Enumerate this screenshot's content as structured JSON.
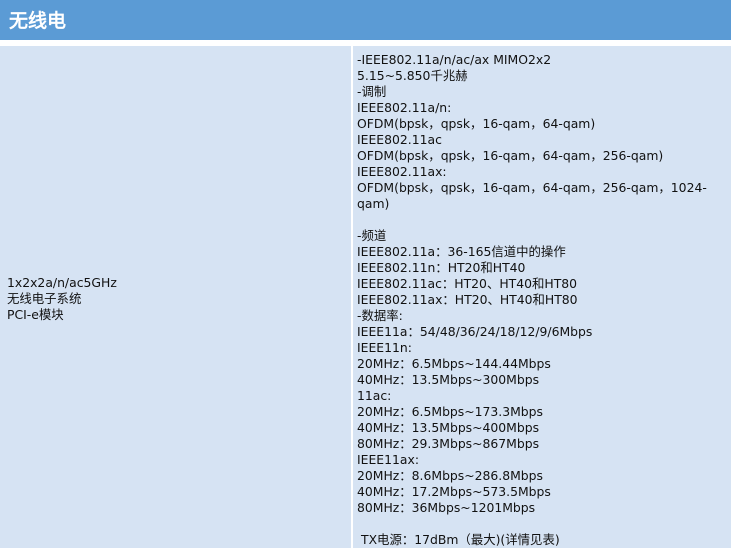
{
  "header": {
    "title": "无线电"
  },
  "row": {
    "left_lines": [
      "1x2x2a/n/ac5GHz",
      "无线电子系统",
      "PCI-e模块"
    ],
    "right_lines": [
      "-IEEE802.11a/n/ac/ax MIMO2x2",
      "5.15~5.850千兆赫",
      "-调制",
      "IEEE802.11a/n:",
      "OFDM(bpsk，qpsk，16-qam，64-qam)",
      "IEEE802.11ac",
      "OFDM(bpsk，qpsk，16-qam，64-qam，256-qam)",
      "IEEE802.11ax:",
      "OFDM(bpsk，qpsk，16-qam，64-qam，256-qam，1024-",
      "qam)",
      "",
      "-频道",
      "IEEE802.11a：36-165信道中的操作",
      "IEEE802.11n：HT20和HT40",
      "IEEE802.11ac：HT20、HT40和HT80",
      "IEEE802.11ax：HT20、HT40和HT80",
      "-数据率:",
      "IEEE11a：54/48/36/24/18/12/9/6Mbps",
      "IEEE11n:",
      "20MHz：6.5Mbps~144.44Mbps",
      "40MHz：13.5Mbps~300Mbps",
      "11ac:",
      "20MHz：6.5Mbps~173.3Mbps",
      "40MHz：13.5Mbps~400Mbps",
      "80MHz：29.3Mbps~867Mbps",
      "IEEE11ax:",
      "20MHz：8.6Mbps~286.8Mbps",
      "40MHz：17.2Mbps~573.5Mbps",
      "80MHz：36Mbps~1201Mbps",
      "",
      "TX电源：17dBm（最大)(详情见表)"
    ]
  },
  "colors": {
    "header_background": "#5b9bd5",
    "row_background": "#d6e3f3",
    "divider": "#ffffff",
    "text": "#111111"
  }
}
